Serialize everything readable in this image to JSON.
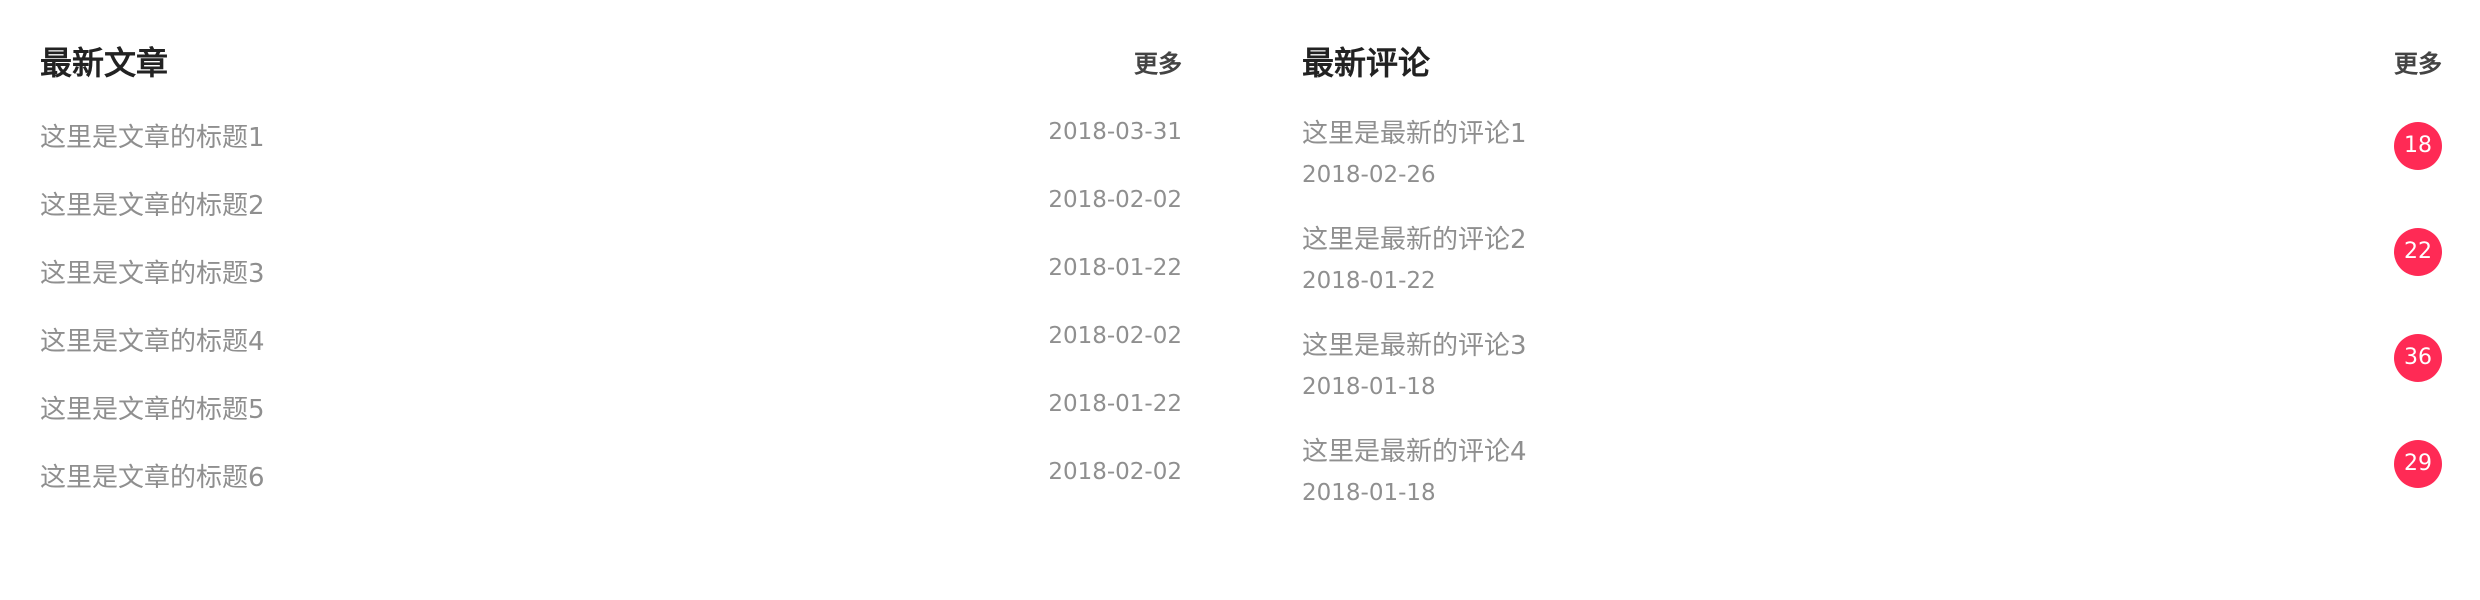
{
  "articles": {
    "title": "最新文章",
    "more_label": "更多",
    "items": [
      {
        "title": "这里是文章的标题1",
        "date": "2018-03-31"
      },
      {
        "title": "这里是文章的标题2",
        "date": "2018-02-02"
      },
      {
        "title": "这里是文章的标题3",
        "date": "2018-01-22"
      },
      {
        "title": "这里是文章的标题4",
        "date": "2018-02-02"
      },
      {
        "title": "这里是文章的标题5",
        "date": "2018-01-22"
      },
      {
        "title": "这里是文章的标题6",
        "date": "2018-02-02"
      }
    ]
  },
  "comments": {
    "title": "最新评论",
    "more_label": "更多",
    "badge_color": "#ff2a55",
    "items": [
      {
        "text": "这里是最新的评论1",
        "date": "2018-02-26",
        "count": "18"
      },
      {
        "text": "这里是最新的评论2",
        "date": "2018-01-22",
        "count": "22"
      },
      {
        "text": "这里是最新的评论3",
        "date": "2018-01-18",
        "count": "36"
      },
      {
        "text": "这里是最新的评论4",
        "date": "2018-01-18",
        "count": "29"
      }
    ]
  }
}
